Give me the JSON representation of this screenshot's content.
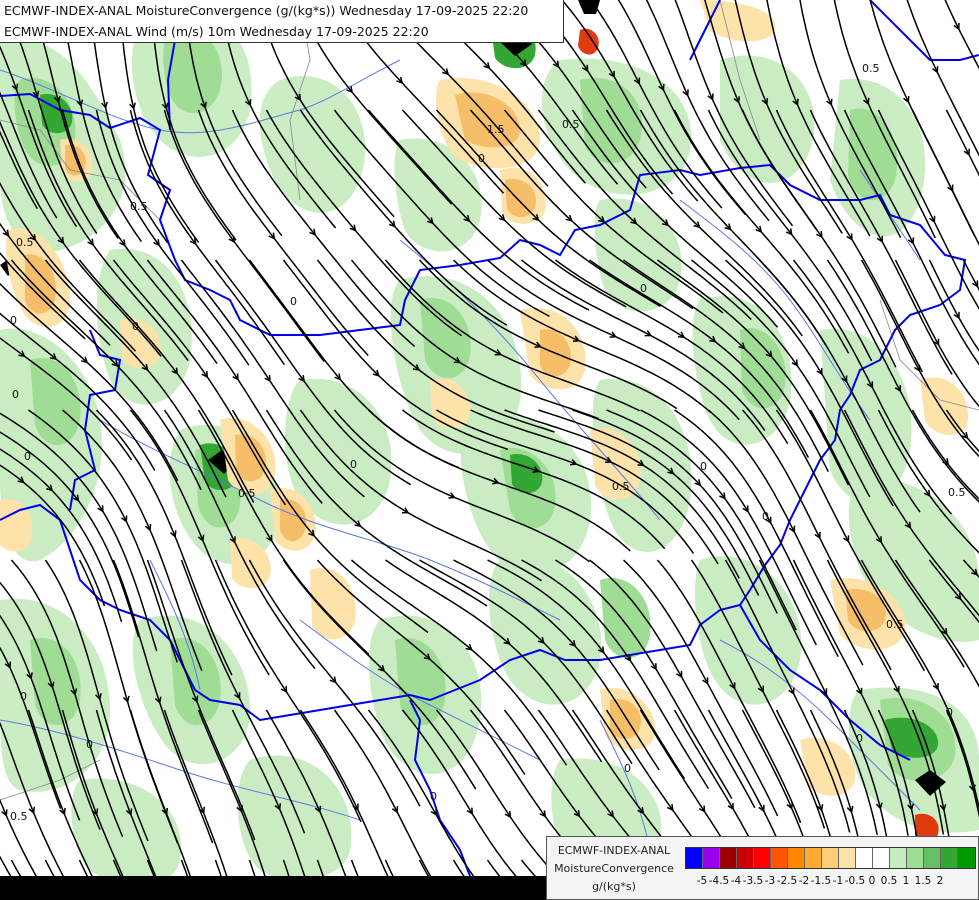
{
  "titles": {
    "line1": "ECMWF-INDEX-ANAL MoistureConvergence (g/(kg*s)) Wednesday 17-09-2025 22:20",
    "line2": "ECMWF-INDEX-ANAL Wind (m/s) 10m Wednesday 17-09-2025 22:20"
  },
  "legend": {
    "line1": "ECMWF-INDEX-ANAL",
    "line2": "MoistureConvergence",
    "line3": "g/(kg*s)",
    "colors": [
      "#0000ff",
      "#9900ee",
      "#990000",
      "#cc0000",
      "#ff0000",
      "#ff5500",
      "#ff8800",
      "#ffaa33",
      "#ffcc77",
      "#fde2aa",
      "#ffffff",
      "#ffffff",
      "#c8ecc0",
      "#9fdc94",
      "#66c066",
      "#33a633",
      "#009900"
    ],
    "tick_labels": [
      "-5",
      "-4.5",
      "-4",
      "-3.5",
      "-3",
      "-2.5",
      "-2",
      "-1.5",
      "-1",
      "-0.5",
      "0",
      "0.5",
      "1",
      "1.5",
      "2"
    ]
  },
  "map": {
    "colors": {
      "background": "#ffffff",
      "light_green": "#c8ecc0",
      "mid_green": "#9fdc94",
      "dark_green": "#2e9e3a",
      "light_orange": "#fde2aa",
      "mid_orange": "#f7be6a",
      "red": "#e03a10",
      "border_blue": "#0000ee",
      "river_blue": "#5a78e8",
      "streamline": "#000000"
    },
    "contour_labels": [
      "1.5",
      "0.5",
      "0.5",
      "0.5",
      "0",
      "0",
      "0",
      "0",
      "0",
      "0",
      "0.5",
      "0.5",
      "0",
      "0",
      "0.5",
      "0.5",
      "0",
      "0",
      "0",
      "0",
      "0.5",
      "0.5",
      "0",
      "0",
      "0",
      "0"
    ]
  }
}
